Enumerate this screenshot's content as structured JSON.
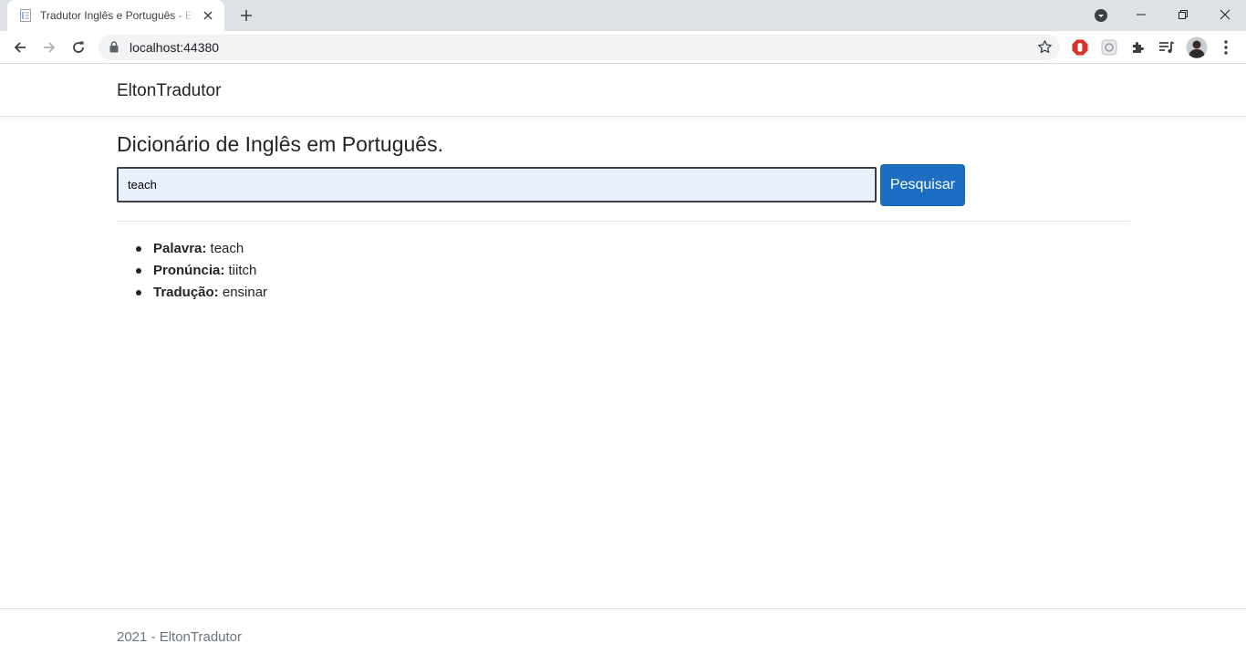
{
  "browser": {
    "tab": {
      "title": "Tradutor Inglês e Português - EltonTradutor",
      "favicon": "document-icon"
    },
    "address_bar": {
      "url": "localhost:44380"
    },
    "icons": [
      "back-icon",
      "forward-icon",
      "reload-icon",
      "lock-icon",
      "star-icon",
      "adblock-extension-icon",
      "extension-icon",
      "puzzle-icon",
      "media-queue-icon",
      "profile-avatar",
      "kebab-menu-icon",
      "tab-search-icon",
      "minimize-icon",
      "restore-icon",
      "close-icon",
      "new-tab-icon"
    ]
  },
  "header": {
    "brand": "EltonTradutor"
  },
  "main": {
    "title": "Dicionário de Inglês em Português.",
    "search": {
      "value": "teach",
      "button_label": "Pesquisar"
    },
    "results": [
      {
        "label": "Palavra:",
        "value": "teach"
      },
      {
        "label": "Pronúncia:",
        "value": "tiitch"
      },
      {
        "label": "Tradução:",
        "value": "ensinar"
      }
    ]
  },
  "footer": {
    "text": "2021 - EltonTradutor"
  },
  "colors": {
    "primary_button": "#1b6ec2",
    "input_autofill": "#e8f0fe",
    "footer_text": "#6c757d"
  }
}
